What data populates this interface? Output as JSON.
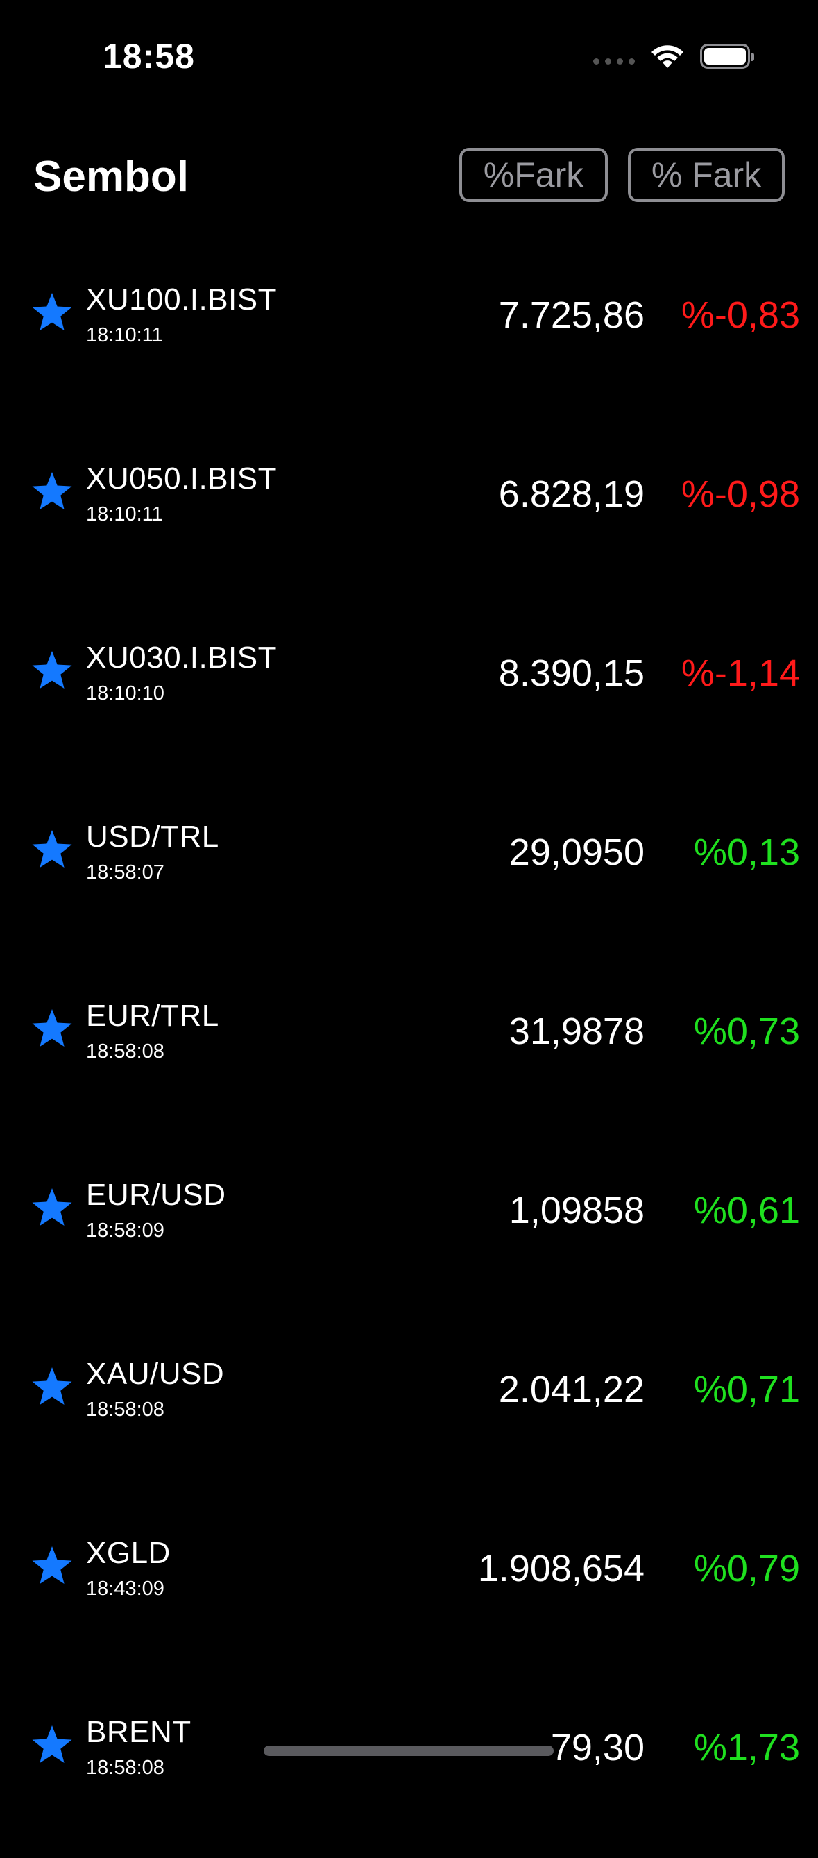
{
  "status_bar": {
    "time": "18:58"
  },
  "header": {
    "title": "Sembol",
    "button_1": "%Fark",
    "button_2": "% Fark"
  },
  "colors": {
    "star": "#1479ff",
    "negative": "#ff1a1a",
    "positive": "#1fe01f",
    "background": "#000000"
  },
  "rows": [
    {
      "symbol": "XU100.I.BIST",
      "time": "18:10:11",
      "price": "7.725,86",
      "change": "%-0,83",
      "direction": "negative"
    },
    {
      "symbol": "XU050.I.BIST",
      "time": "18:10:11",
      "price": "6.828,19",
      "change": "%-0,98",
      "direction": "negative"
    },
    {
      "symbol": "XU030.I.BIST",
      "time": "18:10:10",
      "price": "8.390,15",
      "change": "%-1,14",
      "direction": "negative"
    },
    {
      "symbol": "USD/TRL",
      "time": "18:58:07",
      "price": "29,0950",
      "change": "%0,13",
      "direction": "positive"
    },
    {
      "symbol": "EUR/TRL",
      "time": "18:58:08",
      "price": "31,9878",
      "change": "%0,73",
      "direction": "positive"
    },
    {
      "symbol": "EUR/USD",
      "time": "18:58:09",
      "price": "1,09858",
      "change": "%0,61",
      "direction": "positive"
    },
    {
      "symbol": "XAU/USD",
      "time": "18:58:08",
      "price": "2.041,22",
      "change": "%0,71",
      "direction": "positive"
    },
    {
      "symbol": "XGLD",
      "time": "18:43:09",
      "price": "1.908,654",
      "change": "%0,79",
      "direction": "positive"
    },
    {
      "symbol": "BRENT",
      "time": "18:58:08",
      "price": "79,30",
      "change": "%1,73",
      "direction": "positive"
    }
  ]
}
